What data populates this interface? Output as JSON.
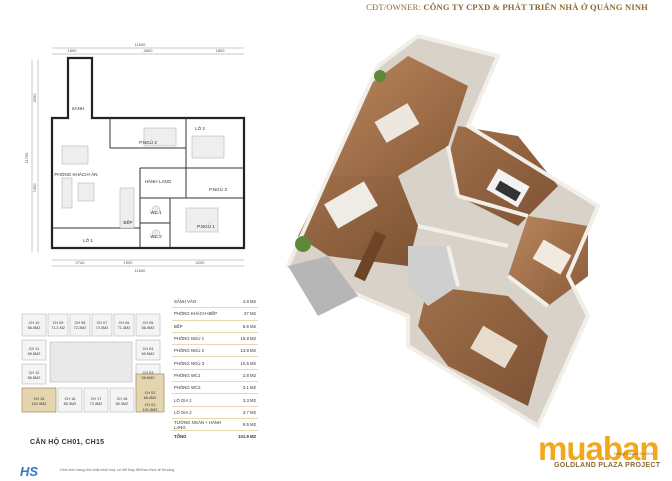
{
  "header": {
    "owner_prefix": "CĐT/OWNER:",
    "owner_name": "CÔNG TY CPXD & PHÁT TRIỂN NHÀ Ở QUẢNG NINH"
  },
  "plan": {
    "rooms": {
      "sanh": "SẢNH",
      "living": "PHÒNG KHÁCH+ĂN",
      "bed2": "P.NGỦ 2",
      "bed3": "P.NGỦ 3",
      "bed1": "P.NGỦ 1",
      "hall": "HÀNH LANG",
      "wc1": "WC 1",
      "wc2": "WC 2",
      "kitchen": "BẾP",
      "lodia1": "LÔ 1",
      "lodia2": "LÔ 2"
    },
    "dims": {
      "top_total": "11600",
      "top_a": "1800",
      "top_b": "4600",
      "top_c": "1800",
      "bottom_total": "11600",
      "bottom_a": "2740",
      "bottom_b": "1900",
      "bottom_c": "4200",
      "left_total": "11750",
      "left_a": "3590",
      "left_b": "7450"
    }
  },
  "building": {
    "units": [
      {
        "code": "CH 10",
        "area": "56.5M2"
      },
      {
        "code": "CH 09",
        "area": "71.3 M2"
      },
      {
        "code": "CH 08",
        "area": "72.3M2"
      },
      {
        "code": "CH 07",
        "area": "72.3M2"
      },
      {
        "code": "CH 06",
        "area": "71.3M2"
      },
      {
        "code": "CH 05",
        "area": "56.5M2"
      },
      {
        "code": "CH 11",
        "area": "69.5M2"
      },
      {
        "code": "CH 04",
        "area": "69.5M2"
      },
      {
        "code": "CH 12",
        "area": "56.6M2"
      },
      {
        "code": "CH 03",
        "area": "56.6M2"
      },
      {
        "code": "CH 02",
        "area": "68.4M2"
      },
      {
        "code": "CH 15",
        "area": "101.9M2"
      },
      {
        "code": "CH 16",
        "area": "80.3M2"
      },
      {
        "code": "CH 17",
        "area": "72.3M2"
      },
      {
        "code": "CH 18",
        "area": "80.3M2"
      },
      {
        "code": "CH 01",
        "area": "101.9M2"
      }
    ],
    "apartment_label": "CĂN HỘ CH01, CH15"
  },
  "area_table": {
    "rows": [
      {
        "name": "SẢNH VÀO",
        "value": "4.8 M2"
      },
      {
        "name": "PHÒNG KHÁCH+BẾP",
        "value": "27 M2"
      },
      {
        "name": "BẾP",
        "value": "6.5 M2"
      },
      {
        "name": "PHÒNG NGỦ 1",
        "value": "15.8 M2"
      },
      {
        "name": "PHÒNG NGỦ 2",
        "value": "13.8 M2"
      },
      {
        "name": "PHÒNG NGỦ 3",
        "value": "10.5 M2"
      },
      {
        "name": "PHÒNG WC1",
        "value": "2.8 M2"
      },
      {
        "name": "PHÒNG WC2",
        "value": "3.1 M2"
      },
      {
        "name": "LÔ GIA 1",
        "value": "3.3 M2"
      },
      {
        "name": "LÔ GIA 2",
        "value": "3.7 M2"
      },
      {
        "name": "TƯỜNG NGĂN + HÀNH LANG",
        "value": "9.5 M2"
      }
    ],
    "total_label": "TỔNG",
    "total_value": "101.9 M2"
  },
  "footer": {
    "note": "Hình ảnh mang tính chất minh họa, có thể thay đổi theo thực tế thi công",
    "hs_logo": "HS",
    "watermark": "muaban",
    "watermark_sub": "mua bán",
    "design_note": "Design Report",
    "design_date": "24.2015",
    "project": "GOLDLAND PLAZA PROJECT"
  },
  "colors": {
    "gold": "#8a6a2e",
    "wood": "#8b5a34",
    "watermark": "#f1a81b"
  }
}
